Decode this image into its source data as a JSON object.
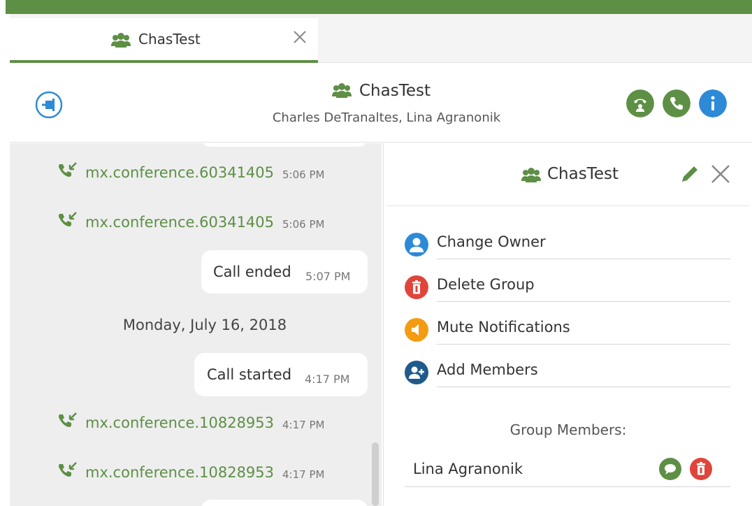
{
  "tab": {
    "label": "ChasTest",
    "icon": "group-icon",
    "close_icon": "close-icon"
  },
  "header": {
    "title": "ChasTest",
    "subtitle": "Charles DeTranaltes, Lina Agranonik",
    "icons": [
      "pin-icon",
      "group-icon",
      "conference-call-icon",
      "phone-icon",
      "info-icon"
    ]
  },
  "colors": {
    "brand_green": "#5d8f45",
    "info_blue": "#2d8ad6",
    "danger_red": "#e0453b",
    "warning_orange": "#f39c12",
    "navy": "#1f5a8a"
  },
  "chat": {
    "calls": [
      {
        "link": "mx.conference.60341405",
        "time": "5:06 PM"
      },
      {
        "link": "mx.conference.60341405",
        "time": "5:06 PM"
      },
      {
        "link": "mx.conference.10828953",
        "time": "4:17 PM"
      },
      {
        "link": "mx.conference.10828953",
        "time": "4:17 PM"
      }
    ],
    "messages": [
      {
        "text": "Call ended",
        "time": "5:07 PM"
      },
      {
        "text": "Call started",
        "time": "4:17 PM"
      }
    ],
    "date_separator": "Monday, July 16, 2018"
  },
  "panel": {
    "title": "ChasTest",
    "actions": [
      {
        "label": "Change Owner",
        "icon": "user-icon",
        "color": "#2d8ad6"
      },
      {
        "label": "Delete Group",
        "icon": "trash-icon",
        "color": "#e0453b"
      },
      {
        "label": "Mute Notifications",
        "icon": "speaker-mute-icon",
        "color": "#f39c12"
      },
      {
        "label": "Add Members",
        "icon": "add-members-icon",
        "color": "#1f5a8a"
      }
    ],
    "members_title": "Group Members:",
    "members": [
      {
        "name": "Lina Agranonik"
      }
    ]
  }
}
